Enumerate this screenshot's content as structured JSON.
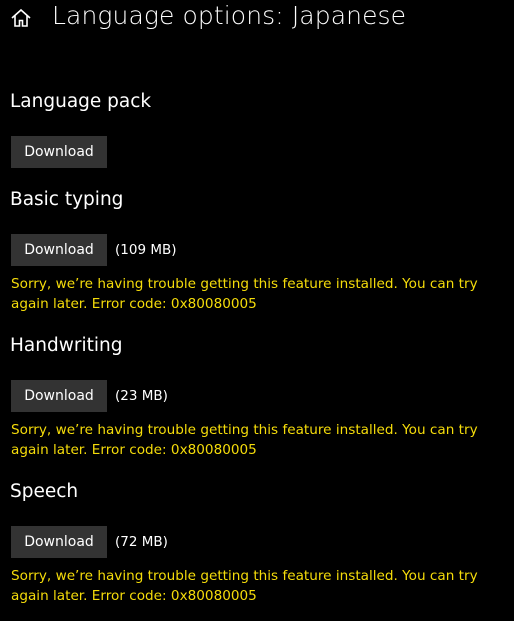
{
  "header": {
    "title": "Language options: Japanese",
    "home_icon": "home-icon"
  },
  "colors": {
    "background": "#000000",
    "text": "#ffffff",
    "button": "#333333",
    "error": "#f5dc0a"
  },
  "sections": [
    {
      "title": "Language pack",
      "button_label": "Download"
    },
    {
      "title": "Basic typing",
      "button_label": "Download",
      "size": "(109 MB)",
      "error": "Sorry, we’re having trouble getting this feature installed. You can try again later. Error code: 0x80080005"
    },
    {
      "title": "Handwriting",
      "button_label": "Download",
      "size": "(23 MB)",
      "error": "Sorry, we’re having trouble getting this feature installed. You can try again later. Error code: 0x80080005"
    },
    {
      "title": "Speech",
      "button_label": "Download",
      "size": "(72 MB)",
      "error": "Sorry, we’re having trouble getting this feature installed. You can try again later. Error code: 0x80080005"
    }
  ]
}
